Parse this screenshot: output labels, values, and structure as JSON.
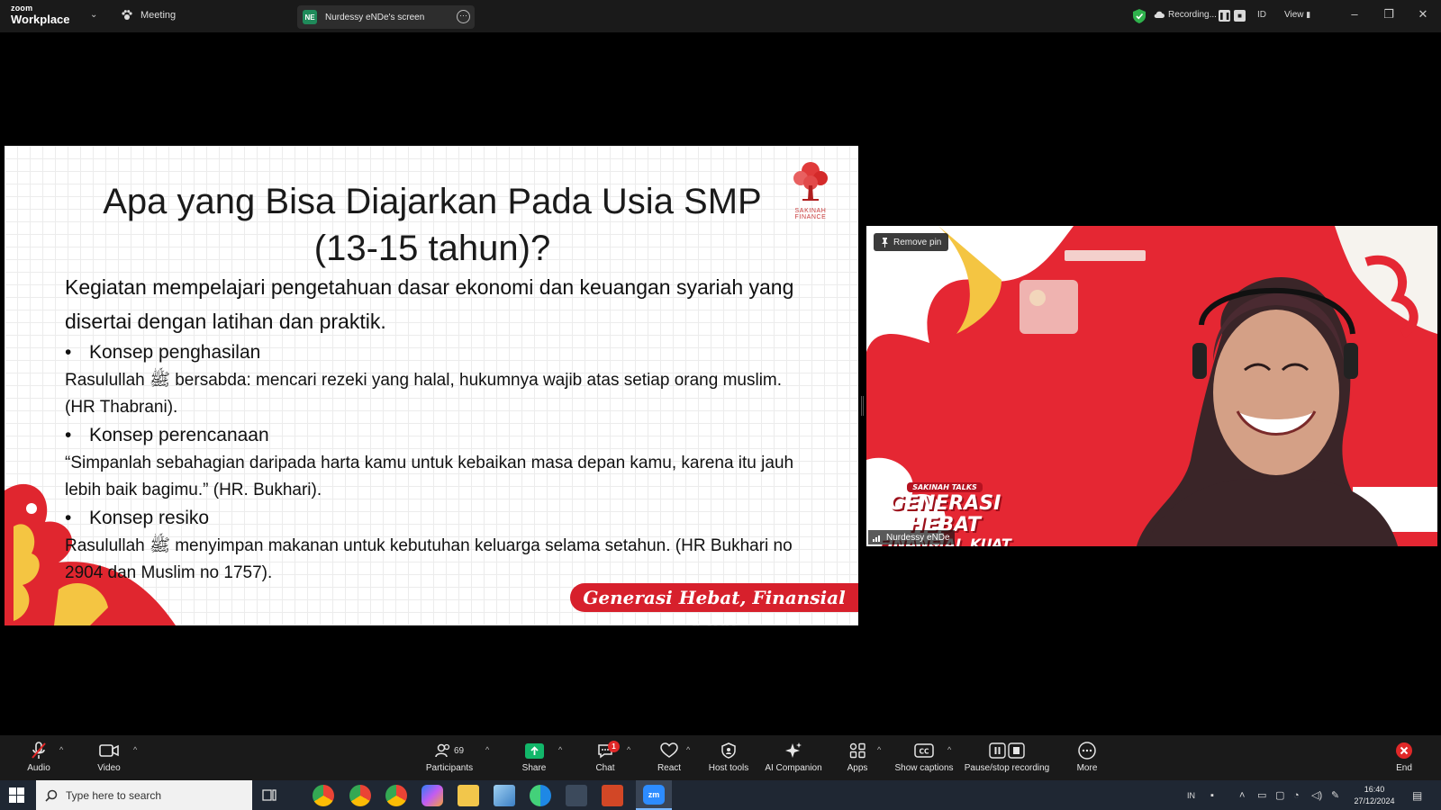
{
  "app": {
    "brand_small": "zoom",
    "brand_big": "Workplace",
    "meeting_label": "Meeting",
    "share_avatar": "NE",
    "share_label": "Nurdessy eNDe's screen",
    "recording_label": "Recording...",
    "id_label": "ID",
    "view_label": "View"
  },
  "slide": {
    "title_line1": "Apa yang Bisa Diajarkan Pada Usia SMP",
    "title_line2": "(13-15 tahun)?",
    "logo_caption": "SAKINAH FINANCE",
    "lead": "Kegiatan mempelajari pengetahuan dasar ekonomi dan keuangan syariah yang disertai dengan latihan dan praktik.",
    "sections": [
      {
        "bullet": "Konsep penghasilan",
        "text": "Rasulullah ﷺ bersabda: mencari rezeki yang halal, hukumnya wajib atas setiap orang muslim. (HR Thabrani)."
      },
      {
        "bullet": "Konsep perencanaan",
        "text": "“Simpanlah sebahagian daripada harta kamu untuk kebaikan masa depan kamu, karena itu jauh lebih baik bagimu.” (HR. Bukhari)."
      },
      {
        "bullet": "Konsep resiko",
        "text": "Rasulullah ﷺ menyimpan makanan untuk kebutuhan keluarga selama setahun. (HR Bukhari no 2904 dan Muslim no 1757)."
      }
    ],
    "tagline": "Generasi Hebat, Finansial Kuat"
  },
  "video": {
    "pin_label": "Remove pin",
    "participant_name": "Nurdessy eNDe",
    "bg_small": "SAKINAH TALKS",
    "bg_big": "GENERASI HEBAT",
    "bg_mid": "FINANSIAL KUAT"
  },
  "toolbar": {
    "audio": "Audio",
    "video": "Video",
    "participants": "Participants",
    "participants_count": "69",
    "share": "Share",
    "chat": "Chat",
    "chat_badge": "1",
    "react": "React",
    "host_tools": "Host tools",
    "ai_companion": "AI Companion",
    "apps": "Apps",
    "show_captions": "Show captions",
    "pause_stop": "Pause/stop recording",
    "more": "More",
    "end": "End"
  },
  "taskbar": {
    "search_placeholder": "Type here to search",
    "lang": "IN",
    "time": "16:40",
    "date": "27/12/2024"
  },
  "colors": {
    "slide_accent": "#d7202c",
    "video_bg": "#e52733",
    "share_green": "#12b76a"
  }
}
